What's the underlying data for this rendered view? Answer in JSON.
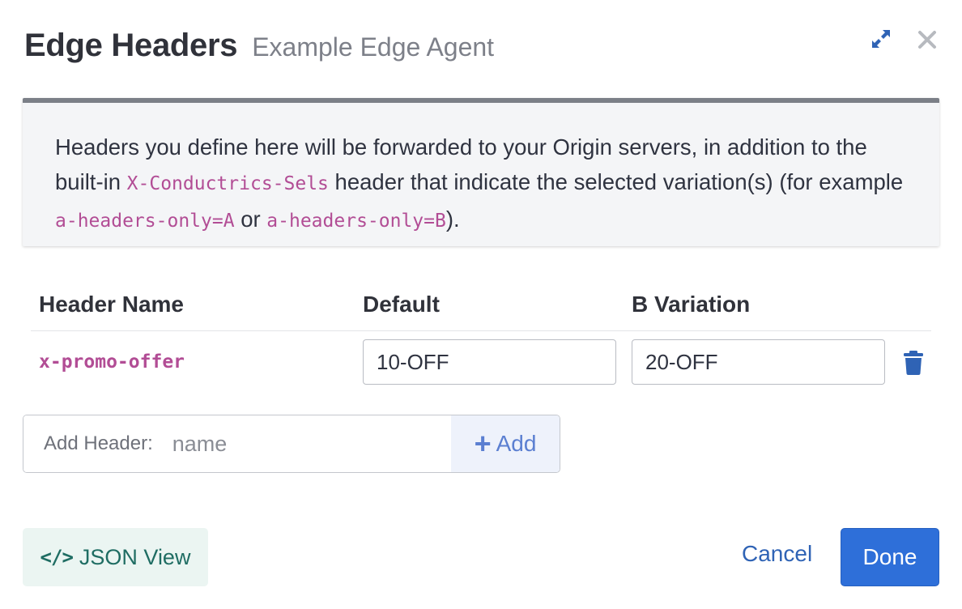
{
  "header": {
    "title": "Edge Headers",
    "subtitle": "Example Edge Agent"
  },
  "info": {
    "text_1": "Headers you define here will be forwarded to your Origin servers, in addition to the built-in ",
    "code_1": "X-Conductrics-Sels",
    "text_2": " header that indicate the selected variation(s) (for example ",
    "code_2": "a-headers-only=A",
    "text_3": " or ",
    "code_3": "a-headers-only=B",
    "text_4": ")."
  },
  "table": {
    "columns": [
      "Header Name",
      "Default",
      "B Variation"
    ],
    "rows": [
      {
        "name": "x-promo-offer",
        "default": "10-OFF",
        "b_variation": "20-OFF"
      }
    ]
  },
  "add_header": {
    "label": "Add Header:",
    "placeholder": "name",
    "button_label": "Add"
  },
  "footer": {
    "json_view_label": "JSON View",
    "cancel_label": "Cancel",
    "done_label": "Done"
  },
  "colors": {
    "accent": "#2e6fd9",
    "code": "#b24d95",
    "json_button_bg": "#ebf5f2"
  },
  "icons": [
    "expand-icon",
    "close-icon",
    "trash-icon",
    "plus-icon",
    "code-icon"
  ]
}
